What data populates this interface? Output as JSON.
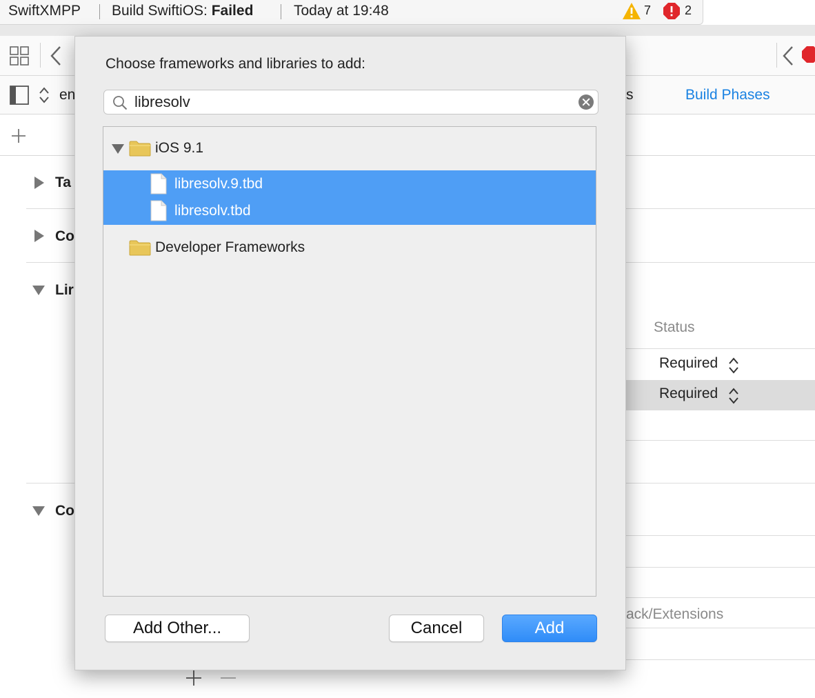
{
  "status_bar": {
    "project": "SwiftXMPP",
    "build_label": "Build SwiftiOS: ",
    "build_result": "Failed",
    "time": "Today at 19:48",
    "warning_count": "7",
    "error_count": "2"
  },
  "background": {
    "tab_partial_left": "en",
    "tab_partial_right": "s",
    "tab_build_phases": "Build Phases",
    "sections": [
      {
        "label": "Ta",
        "expanded": false
      },
      {
        "label": "Co",
        "expanded": false
      },
      {
        "label": "Lir",
        "expanded": true
      },
      {
        "label": "Co",
        "expanded": true
      }
    ],
    "status_header": "Status",
    "rows": [
      {
        "status": "Required"
      },
      {
        "status": "Required"
      }
    ],
    "partial_path": "ack/Extensions"
  },
  "dialog": {
    "title": "Choose frameworks and libraries to add:",
    "search": {
      "value": "libresolv",
      "placeholder": ""
    },
    "tree": [
      {
        "label": "iOS 9.1",
        "kind": "folder",
        "expanded": true,
        "level": 0,
        "selected": false
      },
      {
        "label": "libresolv.9.tbd",
        "kind": "file",
        "level": 1,
        "selected": true
      },
      {
        "label": "libresolv.tbd",
        "kind": "file",
        "level": 1,
        "selected": true
      },
      {
        "label": "Developer Frameworks",
        "kind": "folder",
        "expanded": false,
        "level": 0,
        "selected": false
      }
    ],
    "buttons": {
      "add_other": "Add Other...",
      "cancel": "Cancel",
      "add": "Add"
    }
  },
  "colors": {
    "selection": "#4f9ef5",
    "accent": "#1a82e2",
    "warning": "#f5b400",
    "error": "#e0262b"
  }
}
